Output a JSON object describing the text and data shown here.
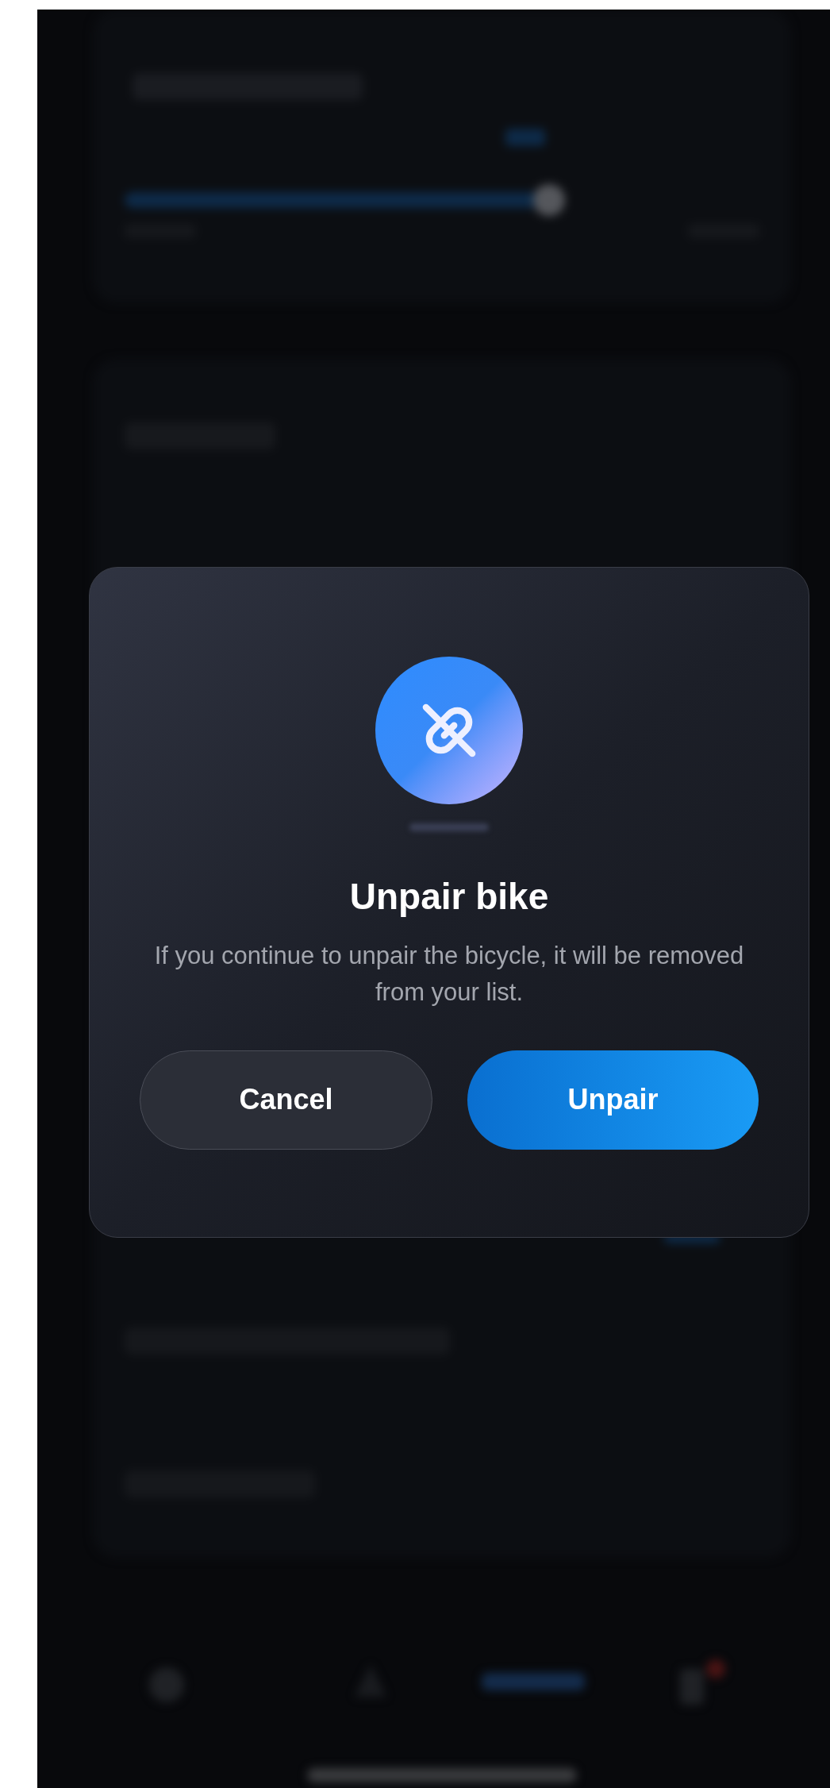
{
  "dialog": {
    "title": "Unpair bike",
    "message": "If you continue to unpair the bicycle, it will be removed from your list.",
    "buttons": [
      {
        "label": "Cancel",
        "kind": "secondary"
      },
      {
        "label": "Unpair",
        "kind": "primary"
      }
    ]
  }
}
